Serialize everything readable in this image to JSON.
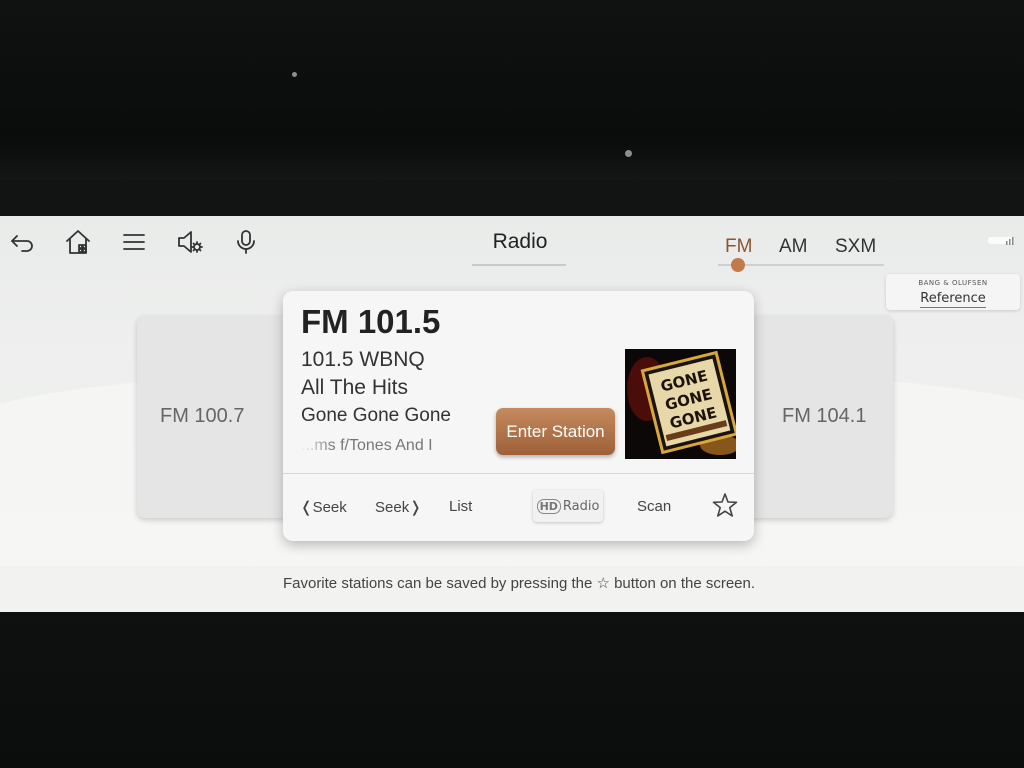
{
  "header": {
    "title": "Radio",
    "bands": [
      "FM",
      "AM",
      "SXM"
    ],
    "active_band": "FM"
  },
  "sound_system": {
    "brand": "BANG & OLUFSEN",
    "mode": "Reference"
  },
  "carousel": {
    "prev_station": "FM 100.7",
    "next_station": "FM 104.1"
  },
  "now_playing": {
    "frequency": "FM 101.5",
    "station_name": "101.5 WBNQ",
    "slogan": "All The Hits",
    "song": "Gone Gone Gone",
    "artist": "...ms f/Tones And I",
    "enter_label": "Enter Station",
    "album_art_text": [
      "GONE",
      "GONE",
      "GONE"
    ]
  },
  "controls": {
    "seek_back": "❬Seek",
    "seek_forward": "Seek❭",
    "list": "List",
    "hd_logo": "HD",
    "hd_label": "Radio",
    "scan": "Scan"
  },
  "hint": "Favorite stations can be saved by pressing the ☆ button on the screen.",
  "colors": {
    "accent": "#c27a4a",
    "enter_button": "#b07248"
  }
}
